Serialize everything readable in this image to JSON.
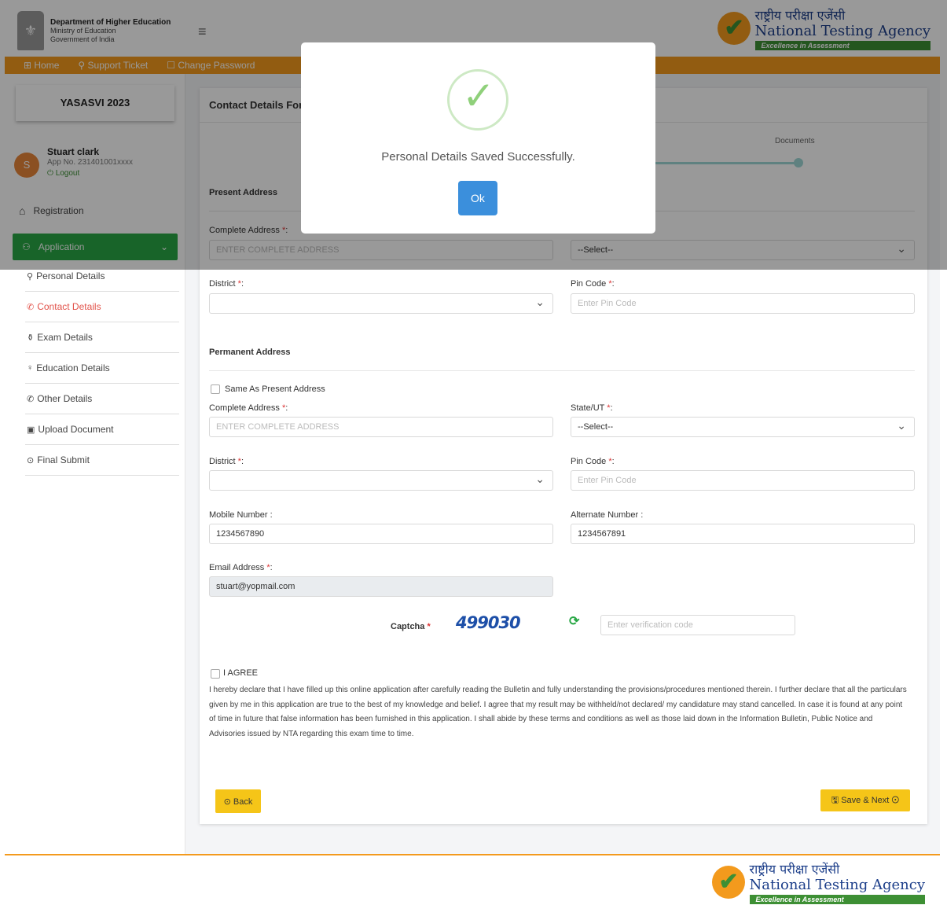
{
  "header": {
    "dept_line1": "Department of Higher Education",
    "dept_line2": "Ministry of Education",
    "dept_line3": "Government of India",
    "nta_hindi": "राष्ट्रीय परीक्षा एजेंसी",
    "nta_english": "National Testing Agency",
    "nta_tagline": "Excellence in Assessment"
  },
  "navbar": {
    "home": "⊞ Home",
    "support": "⚲ Support Ticket",
    "change_password": "☐ Change Password"
  },
  "sidebar": {
    "title": "YASASVI 2023",
    "user_initial": "S",
    "user_name": "Stuart clark",
    "app_no": "App No. 231401001xxxx",
    "logout": "⏻ Logout",
    "registration": "Registration",
    "application": "Application",
    "items": [
      {
        "icon": "⚲",
        "label": "Personal Details"
      },
      {
        "icon": "✆",
        "label": "Contact Details"
      },
      {
        "icon": "⚱",
        "label": "Exam Details"
      },
      {
        "icon": "♀",
        "label": "Education Details"
      },
      {
        "icon": "✆",
        "label": "Other Details"
      },
      {
        "icon": "▣",
        "label": "Upload Document"
      },
      {
        "icon": "⊙",
        "label": "Final Submit"
      }
    ]
  },
  "form": {
    "title": "Contact Details Form",
    "step_label": "Documents",
    "present_address": "Present Address",
    "complete_address_label": "Complete Address",
    "complete_address_placeholder": "ENTER COMPLETE ADDRESS",
    "state_label": "State/UT",
    "select_placeholder": "--Select--",
    "district_label": "District",
    "pincode_label": "Pin Code",
    "pincode_placeholder": "Enter Pin Code",
    "permanent_address": "Permanent Address",
    "same_as_present": "Same As Present Address",
    "mobile_label": "Mobile Number :",
    "mobile_value": "1234567890",
    "alternate_label": "Alternate Number :",
    "alternate_value": "1234567891",
    "email_label": "Email Address",
    "email_value": "stuart@yopmail.com",
    "captcha_label": "Captcha",
    "captcha_text": "499030",
    "captcha_placeholder": "Enter verification code",
    "agree_label": "I AGREE",
    "declaration": "I hereby declare that I have filled up this online application after carefully reading the Bulletin and fully understanding the provisions/procedures mentioned therein. I further declare that all the particulars given by me in this application are true to the best of my knowledge and belief. I agree that my result may be withheld/not declared/ my candidature may stand cancelled. In case it is found at any point of time in future that false information has been furnished in this application. I shall abide by these terms and conditions as well as those laid down in the Information Bulletin, Public Notice and Advisories issued by NTA regarding this exam time to time.",
    "back_button": "⊙ Back",
    "save_next_button": "🖫 Save & Next ⊙"
  },
  "modal": {
    "message": "Personal Details Saved Successfully.",
    "ok_button": "Ok"
  },
  "colors": {
    "accent_orange": "#f39a1d",
    "green": "#28a745",
    "button_yellow": "#f5c518",
    "ok_blue": "#3b8fdc"
  }
}
